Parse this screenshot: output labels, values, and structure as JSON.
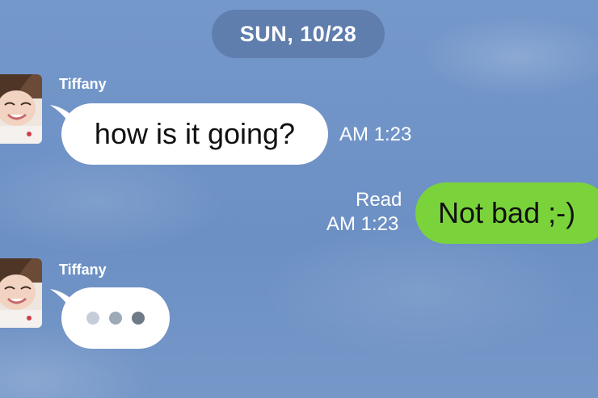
{
  "date_separator": "SUN, 10/28",
  "messages": [
    {
      "sender": "Tiffany",
      "text": "how is it going?",
      "time": "AM 1:23"
    },
    {
      "read_label": "Read",
      "time": "AM 1:23",
      "text": "Not bad ;-)"
    },
    {
      "sender": "Tiffany",
      "typing_indicator": [
        "dot-light",
        "dot-medium",
        "dot-dark"
      ]
    }
  ],
  "colors": {
    "outgoing_bubble": "#7bd33c",
    "incoming_bubble": "#ffffff",
    "background": "#6f93c5"
  }
}
